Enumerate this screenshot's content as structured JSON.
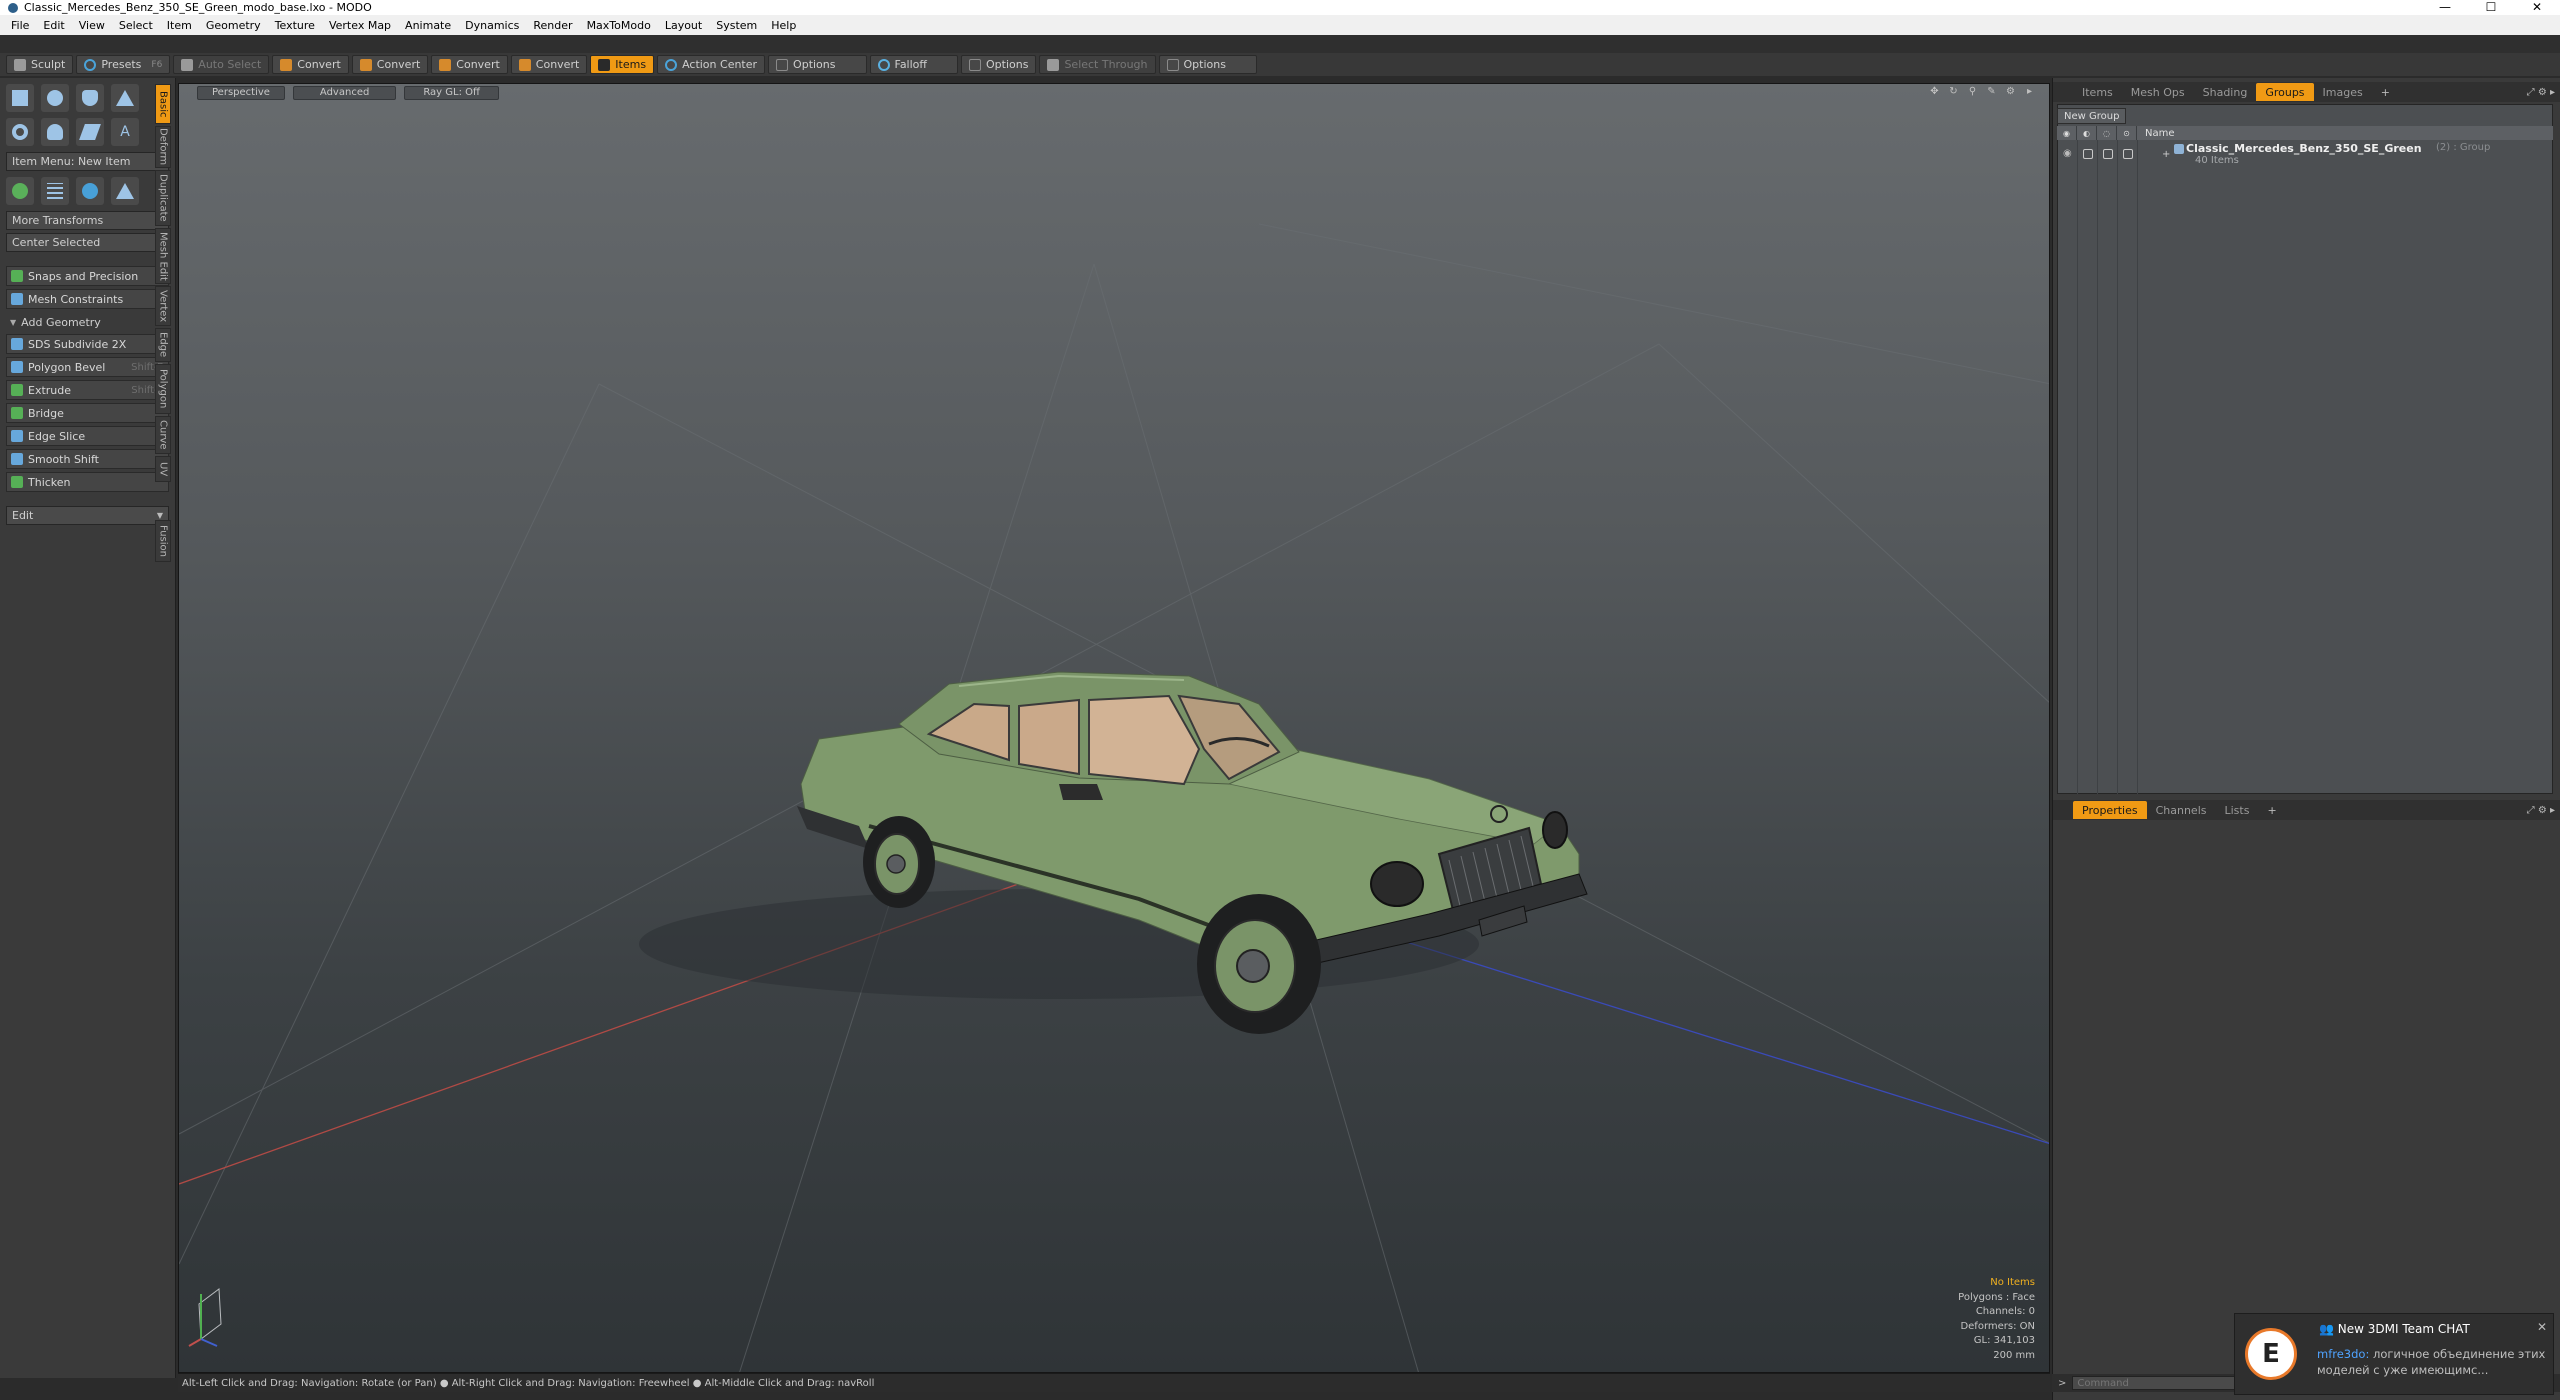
{
  "window": {
    "title": "Classic_Mercedes_Benz_350_SE_Green_modo_base.lxo - MODO",
    "controls": [
      "—",
      "☐",
      "✕"
    ]
  },
  "menu": [
    "File",
    "Edit",
    "View",
    "Select",
    "Item",
    "Geometry",
    "Texture",
    "Vertex Map",
    "Animate",
    "Dynamics",
    "Render",
    "MaxToModo",
    "Layout",
    "System",
    "Help"
  ],
  "toolbar": {
    "sculpt": "Sculpt",
    "presets": "Presets",
    "presets_key": "F6",
    "auto_select": "Auto Select",
    "convert1": "Convert",
    "convert2": "Convert",
    "convert3": "Convert",
    "convert4": "Convert",
    "items": "Items",
    "action_center": "Action Center",
    "options1": "Options",
    "falloff": "Falloff",
    "options2": "Options",
    "select_through": "Select Through",
    "options3": "Options"
  },
  "left_panel": {
    "item_menu": "Item Menu: New Item",
    "more_transforms": "More Transforms",
    "center_selected": "Center Selected",
    "snaps": "Snaps and Precision",
    "mesh_constraints": "Mesh Constraints",
    "add_geometry": "Add Geometry",
    "sds_subdivide": "SDS Subdivide 2X",
    "polygon_bevel": "Polygon Bevel",
    "polygon_bevel_key": "Shift-B",
    "extrude": "Extrude",
    "extrude_key": "Shift-X",
    "bridge": "Bridge",
    "edge_slice": "Edge Slice",
    "smooth_shift": "Smooth Shift",
    "thicken": "Thicken",
    "edit": "Edit"
  },
  "vertical_tabs": [
    "Basic",
    "Deform",
    "Duplicate",
    "Mesh Edit",
    "Vertex",
    "Edge",
    "Polygon",
    "Curve",
    "UV",
    "Fusion"
  ],
  "viewport": {
    "perspective": "Perspective",
    "advanced": "Advanced",
    "raygl": "Ray GL: Off",
    "info": {
      "no_items": "No Items",
      "polygons": "Polygons : Face",
      "channels": "Channels: 0",
      "deformers": "Deformers: ON",
      "gl": "GL: 341,103",
      "scale": "200 mm"
    },
    "car_color": "#7f9a6c"
  },
  "status_bar": "Alt-Left Click and Drag: Navigation: Rotate (or Pan) ● Alt-Right Click and Drag: Navigation: Freewheel ● Alt-Middle Click and Drag: navRoll",
  "right_panel": {
    "tabs": [
      "Items",
      "Mesh Ops",
      "Shading",
      "Groups",
      "Images",
      "+"
    ],
    "active_tab": "Groups",
    "new_group": "New Group",
    "column_name": "Name",
    "group": {
      "name": "Classic_Mercedes_Benz_350_SE_Green",
      "type": "(2) : Group",
      "count": "40 Items"
    },
    "lower_tabs": [
      "Properties",
      "Channels",
      "Lists",
      "+"
    ],
    "command_prompt": ">",
    "command_placeholder": "Command"
  },
  "notification": {
    "title": "New 3DMI Team CHAT",
    "sender": "mfre3do:",
    "message": "логичное объединение этих моделей с уже имеющимс...",
    "avatar_letter": "E"
  },
  "colors": {
    "accent": "#f09a14",
    "x_axis": "#c0504d",
    "z_axis": "#4050c0"
  }
}
